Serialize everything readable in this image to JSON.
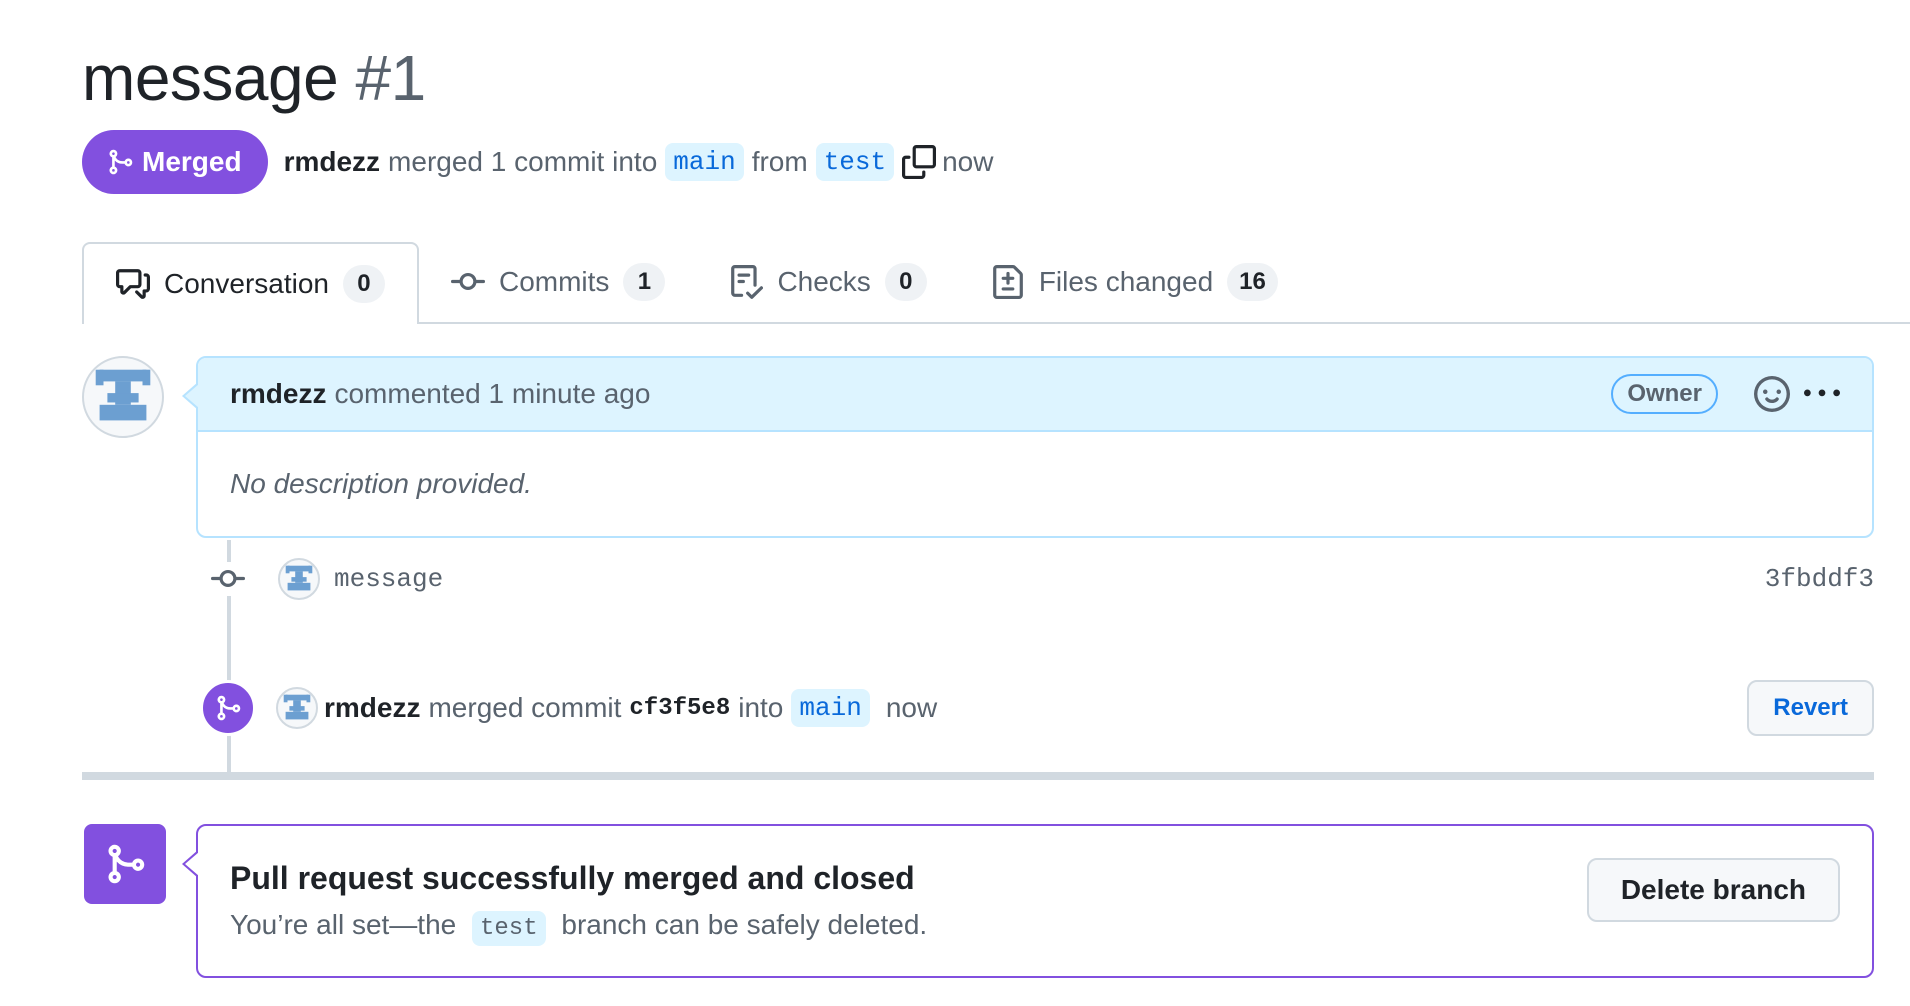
{
  "pr": {
    "title": "message",
    "number": "#1",
    "state": "Merged",
    "author": "rmdezz",
    "summary": "merged 1 commit into",
    "base_branch": "main",
    "from_text": "from",
    "head_branch": "test",
    "time": "now"
  },
  "tabs": [
    {
      "label": "Conversation",
      "count": "0"
    },
    {
      "label": "Commits",
      "count": "1"
    },
    {
      "label": "Checks",
      "count": "0"
    },
    {
      "label": "Files changed",
      "count": "16"
    }
  ],
  "comment": {
    "author": "rmdezz",
    "action": "commented 1 minute ago",
    "badge": "Owner",
    "body": "No description provided."
  },
  "commit": {
    "message": "message",
    "sha": "3fbddf3"
  },
  "merge_event": {
    "author": "rmdezz",
    "text": "merged commit",
    "sha": "cf3f5e8",
    "into": "into",
    "branch": "main",
    "time": "now",
    "revert_label": "Revert"
  },
  "merged_box": {
    "title": "Pull request successfully merged and closed",
    "desc_before": "You’re all set—the",
    "branch": "test",
    "desc_after": "branch can be safely deleted.",
    "delete_label": "Delete branch"
  },
  "colors": {
    "merged_purple": "#8250df",
    "link_blue": "#0969da",
    "comment_header_bg": "#ddf4ff"
  },
  "icons": [
    "git-merge-icon",
    "copy-icon",
    "comment-discussion-icon",
    "git-commit-icon",
    "checklist-icon",
    "file-diff-icon",
    "smiley-icon",
    "kebab-horizontal-icon",
    "identicon-avatar"
  ]
}
